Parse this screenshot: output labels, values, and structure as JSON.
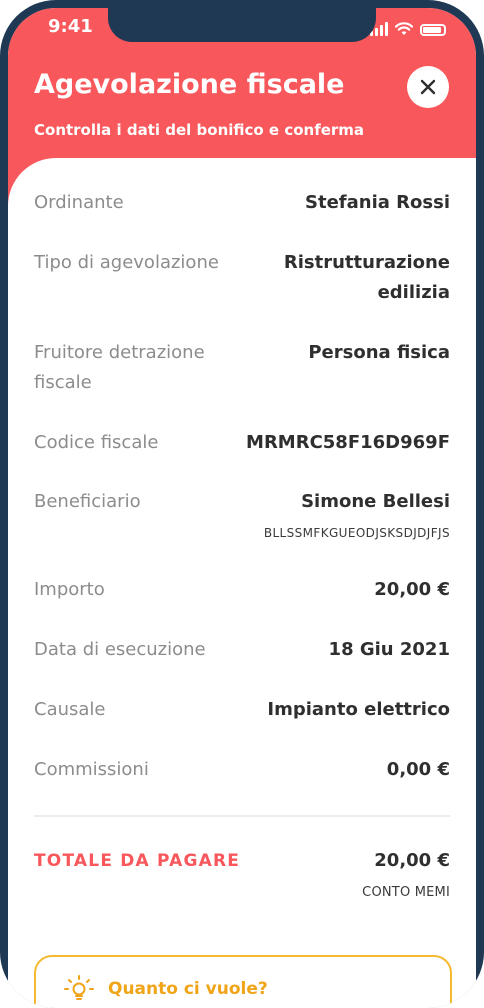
{
  "status_bar": {
    "time": "9:41"
  },
  "header": {
    "title": "Agevolazione fiscale",
    "subtitle": "Controlla i dati del bonifico e conferma",
    "close_icon": "close-icon"
  },
  "details": [
    {
      "label": "Ordinante",
      "value": "Stefania Rossi"
    },
    {
      "label": "Tipo di agevolazione",
      "value": "Ristrutturazione edilizia"
    },
    {
      "label": "Fruitore detrazione fiscale",
      "value": "Persona fisica"
    },
    {
      "label": "Codice fiscale",
      "value": "MRMRC58F16D969F"
    },
    {
      "label": "Beneficiario",
      "value": "Simone Bellesi",
      "sub": "BLLSSMFKGUEODJSKSDJDJFJS"
    },
    {
      "label": "Importo",
      "value": "20,00 €"
    },
    {
      "label": "Data di esecuzione",
      "value": "18 Giu 2021"
    },
    {
      "label": "Causale",
      "value": "Impianto elettrico"
    },
    {
      "label": "Commissioni",
      "value": "0,00 €"
    }
  ],
  "total": {
    "label": "TOTALE DA PAGARE",
    "value": "20,00 €",
    "account": "CONTO MEMI"
  },
  "hint": {
    "icon": "lightbulb-icon",
    "text": "Quanto ci vuole?"
  },
  "colors": {
    "brand": "#f8585c",
    "frame": "#1f3954",
    "hint": "#f5b82e"
  }
}
